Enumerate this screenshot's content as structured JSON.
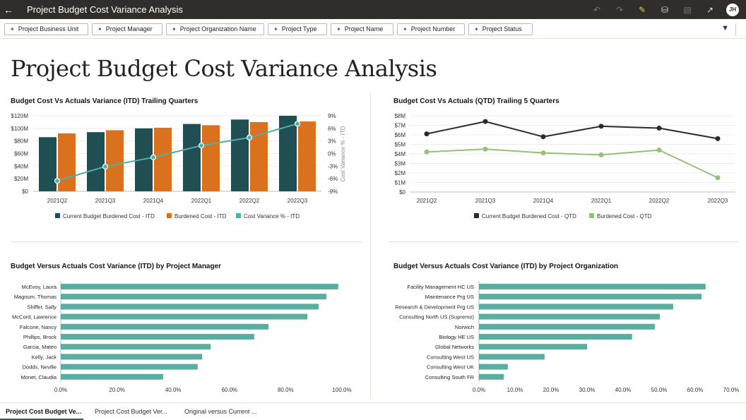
{
  "header": {
    "title": "Project Budget Cost Variance Analysis",
    "avatar_initials": "JH",
    "icons": [
      "back-arrow-icon",
      "undo-icon",
      "redo-icon",
      "edit-icon",
      "data-icon",
      "comment-icon",
      "present-icon"
    ]
  },
  "filters": [
    "Project Business Unit",
    "Project Manager",
    "Project Organization Name",
    "Project Type",
    "Project Name",
    "Project Number",
    "Project Status"
  ],
  "page_title": "Project Budget Cost Variance Analysis",
  "tabs": [
    "Project Cost Budget Ve...",
    "Project Cost Budget Ver...",
    "Original versus Current ..."
  ],
  "colors": {
    "budget_itd": "#1f4e53",
    "burdened_itd": "#d9711e",
    "variance": "#4fb0a5",
    "budget_qtd": "#2b2b2b",
    "burdened_qtd": "#93c17a",
    "hbar": "#5aae9f"
  },
  "chart_data": [
    {
      "type": "bar",
      "title": "Budget Cost Vs Actuals Variance (ITD) Trailing Quarters",
      "categories": [
        "2021Q2",
        "2021Q3",
        "2021Q4",
        "2022Q1",
        "2022Q2",
        "2022Q3"
      ],
      "yticks": [
        "$0",
        "$20M",
        "$40M",
        "$60M",
        "$80M",
        "$100M",
        "$120M"
      ],
      "ylim": [
        0,
        120
      ],
      "y2ticks": [
        "-9%",
        "-6%",
        "-3%",
        "0%",
        "3%",
        "6%",
        "9%"
      ],
      "y2lim": [
        -9,
        9
      ],
      "y2label": "Cost Variance % - ITD",
      "series": [
        {
          "name": "Current Budget Burdened Cost - ITD",
          "type": "bar",
          "values": [
            86,
            94,
            100,
            107,
            114,
            120
          ]
        },
        {
          "name": "Burdened Cost - ITD",
          "type": "bar",
          "values": [
            92,
            97,
            101,
            105,
            110,
            111
          ]
        },
        {
          "name": "Cost Variance % - ITD",
          "type": "line",
          "axis": "y2",
          "values": [
            -6.5,
            -3.1,
            -0.9,
            1.9,
            3.8,
            7.1
          ]
        }
      ],
      "legend": "bottom"
    },
    {
      "type": "line",
      "title": "Budget Cost Vs Actuals (QTD) Trailing 5 Quarters",
      "categories": [
        "2021Q2",
        "2021Q3",
        "2021Q4",
        "2022Q1",
        "2022Q2",
        "2022Q3"
      ],
      "yticks": [
        "$0",
        "$1M",
        "$2M",
        "$3M",
        "$4M",
        "$5M",
        "$6M",
        "$7M",
        "$8M"
      ],
      "ylim": [
        0,
        8
      ],
      "series": [
        {
          "name": "Current Budget Burdened Cost - QTD",
          "values": [
            6.1,
            7.4,
            5.8,
            6.9,
            6.7,
            5.6
          ]
        },
        {
          "name": "Burdened Cost - QTD",
          "values": [
            4.2,
            4.5,
            4.1,
            3.9,
            4.4,
            1.5
          ]
        }
      ],
      "legend": "bottom"
    },
    {
      "type": "bar",
      "orientation": "horizontal",
      "title": "Budget Versus Actuals Cost Variance (ITD) by Project Manager",
      "categories": [
        "McEvoy, Laura",
        "Magnum, Thomas",
        "Shiffer, Sally",
        "McCord, Lawrence",
        "Falcone, Nancy",
        "Phillips, Brock",
        "Garcia, Mateo",
        "Kelly, Jack",
        "Dodds, Neville",
        "Monet, Claudia"
      ],
      "values": [
        98.7,
        94.5,
        91.7,
        87.7,
        73.9,
        68.8,
        53.3,
        50.3,
        48.7,
        36.4
      ],
      "xticks": [
        "0.0%",
        "20.0%",
        "40.0%",
        "60.0%",
        "80.0%",
        "100.0%"
      ],
      "xlim": [
        0,
        100
      ]
    },
    {
      "type": "bar",
      "orientation": "horizontal",
      "title": "Budget Versus Actuals Cost Variance (ITD) by Project Organization",
      "categories": [
        "Facility Management HC US",
        "Maintenance Prg US",
        "Research & Development Prg US",
        "Consulting North US (Supremo)",
        "Norwich",
        "Biology HE US",
        "Global Networks",
        "Consulting West US",
        "Consulting West UK",
        "Consulting South FR"
      ],
      "values": [
        62.9,
        61.8,
        53.9,
        50.2,
        48.8,
        42.5,
        30.0,
        18.2,
        8.0,
        6.9
      ],
      "xticks": [
        "0.0%",
        "10.0%",
        "20.0%",
        "30.0%",
        "40.0%",
        "50.0%",
        "60.0%",
        "70.0%"
      ],
      "xlim": [
        0,
        70
      ]
    }
  ]
}
